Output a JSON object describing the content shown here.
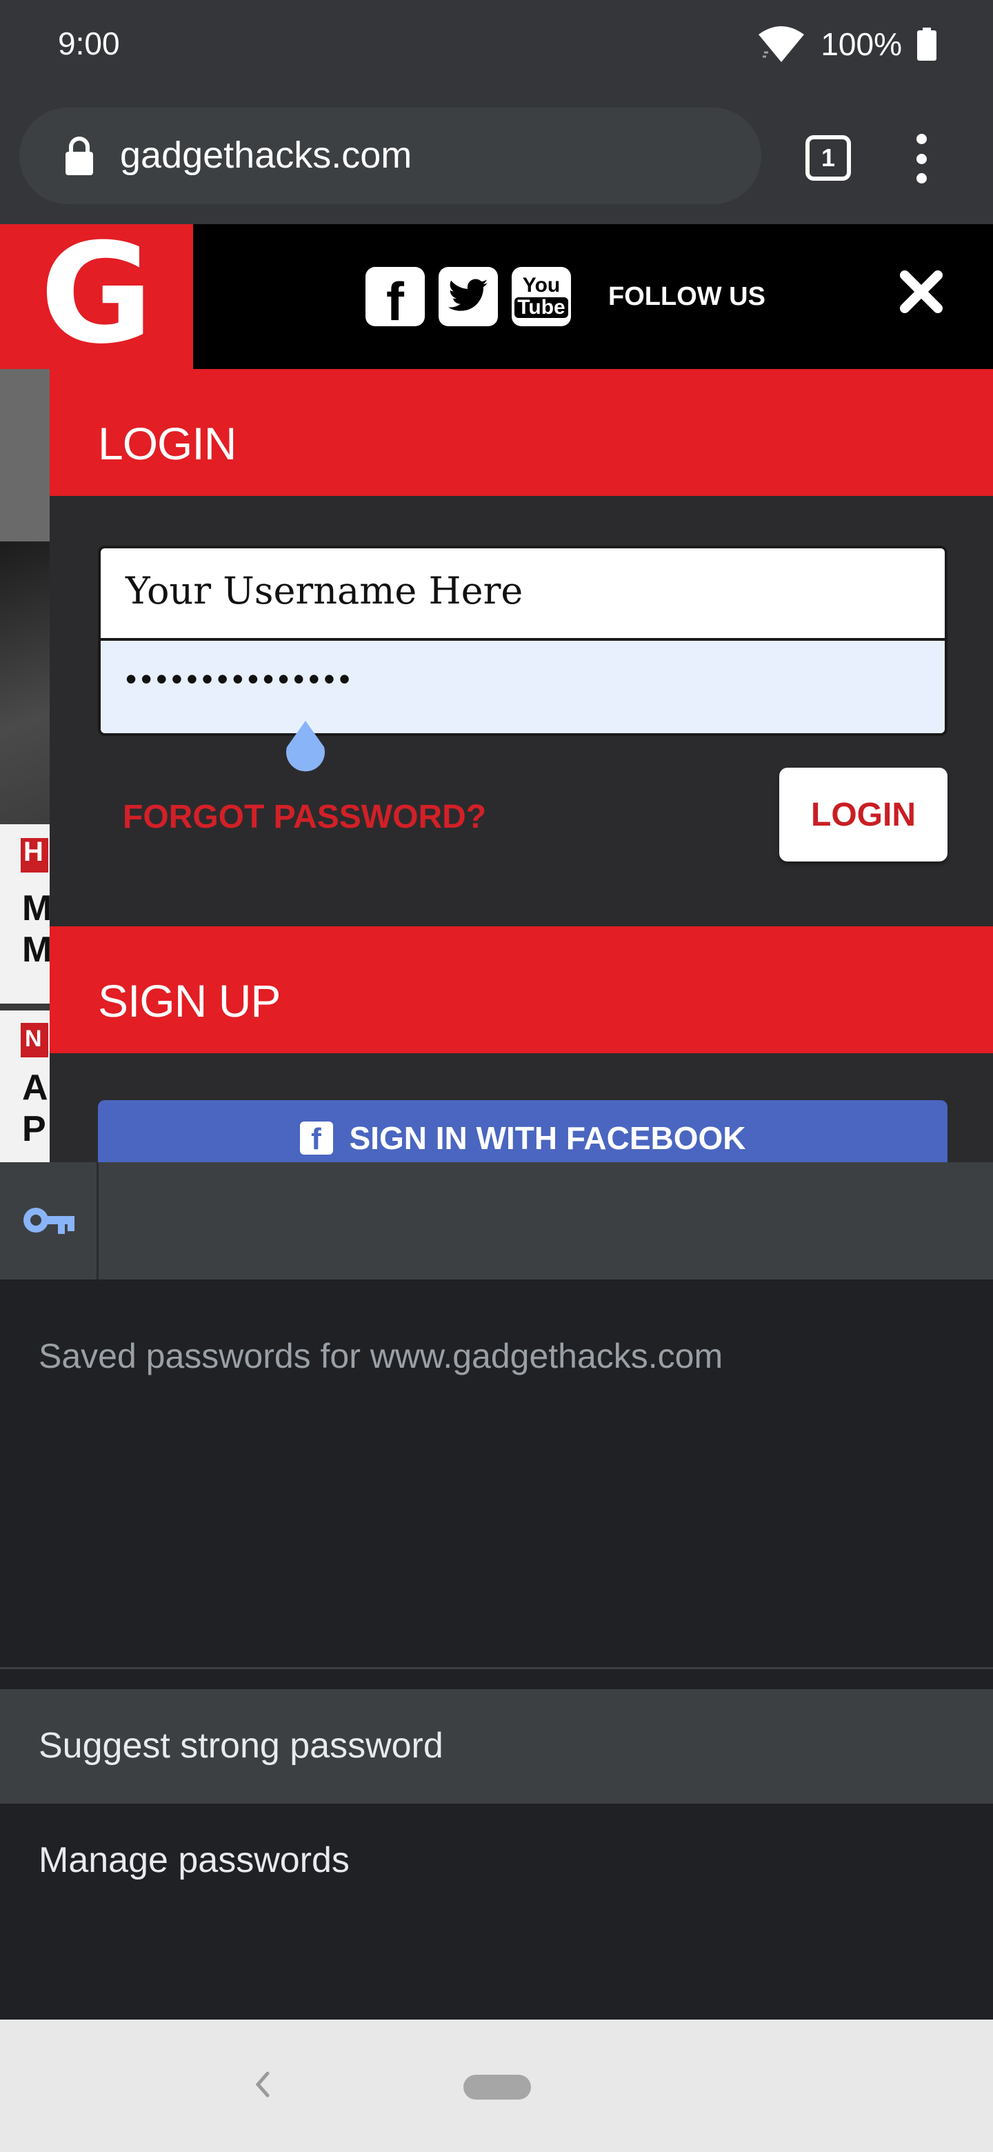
{
  "status_bar": {
    "time": "9:00",
    "battery": "100%"
  },
  "browser": {
    "url": "gadgethacks.com",
    "tab_count": "1"
  },
  "site": {
    "logo_letter": "G",
    "social": {
      "facebook": "f",
      "youtube_top": "You",
      "youtube_bottom": "Tube"
    },
    "follow_us": "FOLLOW US"
  },
  "login_form": {
    "title": "LOGIN",
    "username_value": "Your Username Here",
    "password_mask": "•••••••••••••••",
    "forgot_password": "FORGOT PASSWORD?",
    "login_button": "LOGIN"
  },
  "signup": {
    "title": "SIGN UP",
    "facebook_button": "SIGN IN WITH FACEBOOK",
    "facebook_glyph": "f"
  },
  "background_peek": {
    "tag1": "H",
    "line1": "M",
    "line2": "M",
    "tag2": "N",
    "line3": "A",
    "line4": "P"
  },
  "password_sheet": {
    "heading": "Saved passwords for www.gadgethacks.com",
    "suggest": "Suggest strong password",
    "manage": "Manage passwords"
  },
  "colors": {
    "brand_red": "#e31e24",
    "autofill_blue": "#e8f0fe",
    "facebook_blue": "#4a66c0",
    "key_icon_blue": "#8ab4f8"
  }
}
